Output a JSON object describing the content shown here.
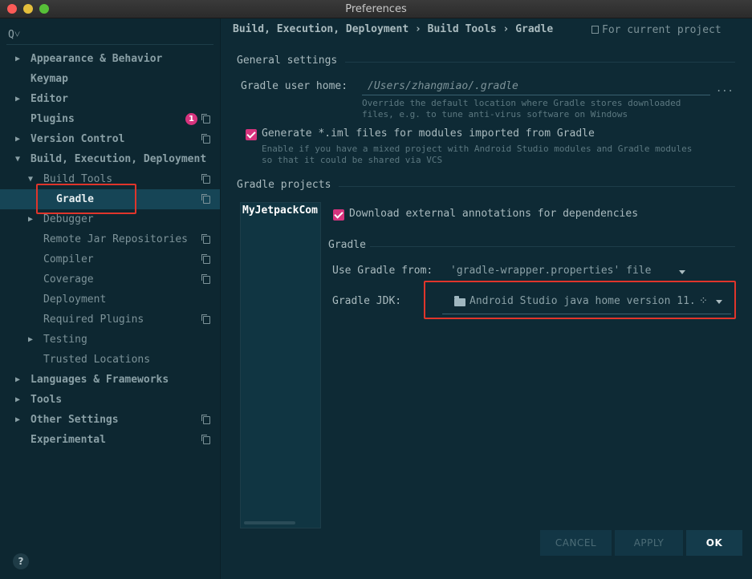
{
  "window": {
    "title": "Preferences"
  },
  "sidebar": {
    "search_icon": "Q˅",
    "items": [
      {
        "label": "Appearance & Behavior",
        "arrow": "▶"
      },
      {
        "label": "Keymap"
      },
      {
        "label": "Editor",
        "arrow": "▶"
      },
      {
        "label": "Plugins",
        "badge": "1"
      },
      {
        "label": "Version Control",
        "arrow": "▶"
      },
      {
        "label": "Build, Execution, Deployment",
        "arrow": "▼"
      },
      {
        "label": "Build Tools",
        "arrow": "▼"
      },
      {
        "label": "Gradle"
      },
      {
        "label": "Debugger",
        "arrow": "▶"
      },
      {
        "label": "Remote Jar Repositories"
      },
      {
        "label": "Compiler"
      },
      {
        "label": "Coverage"
      },
      {
        "label": "Deployment"
      },
      {
        "label": "Required Plugins"
      },
      {
        "label": "Testing",
        "arrow": "▶"
      },
      {
        "label": "Trusted Locations"
      },
      {
        "label": "Languages & Frameworks",
        "arrow": "▶"
      },
      {
        "label": "Tools",
        "arrow": "▶"
      },
      {
        "label": "Other Settings",
        "arrow": "▶"
      },
      {
        "label": "Experimental"
      }
    ],
    "help_label": "?"
  },
  "main": {
    "breadcrumb": "Build, Execution, Deployment › Build Tools › Gradle",
    "for_project": "For current project",
    "general": {
      "title": "General settings",
      "user_home_label": "Gradle user home:",
      "user_home_placeholder": "/Users/zhangmiao/.gradle",
      "user_home_hint_1": "Override the default location where Gradle stores downloaded",
      "user_home_hint_2": "files, e.g. to tune anti-virus software on Windows",
      "browse": "...",
      "iml_label": "Generate *.iml files for modules imported from Gradle",
      "iml_hint_1": "Enable if you have a mixed project with Android Studio modules and Gradle modules",
      "iml_hint_2": "so that it could be shared via VCS"
    },
    "projects": {
      "title": "Gradle projects",
      "list": [
        "MyJetpackCom"
      ],
      "download_annotations_label": "Download external annotations for dependencies",
      "gradle_section": "Gradle",
      "use_gradle_from_label": "Use Gradle from:",
      "use_gradle_from_value": "'gradle-wrapper.properties' file",
      "jdk_label": "Gradle JDK:",
      "jdk_value": "Android Studio java home version 11.",
      "spinner": "⁘"
    }
  },
  "buttons": {
    "cancel": "CANCEL",
    "apply": "APPLY",
    "ok": "OK"
  },
  "colors": {
    "accent": "#d6337d",
    "highlight": "#e0352b",
    "background": "#0e2a35"
  }
}
